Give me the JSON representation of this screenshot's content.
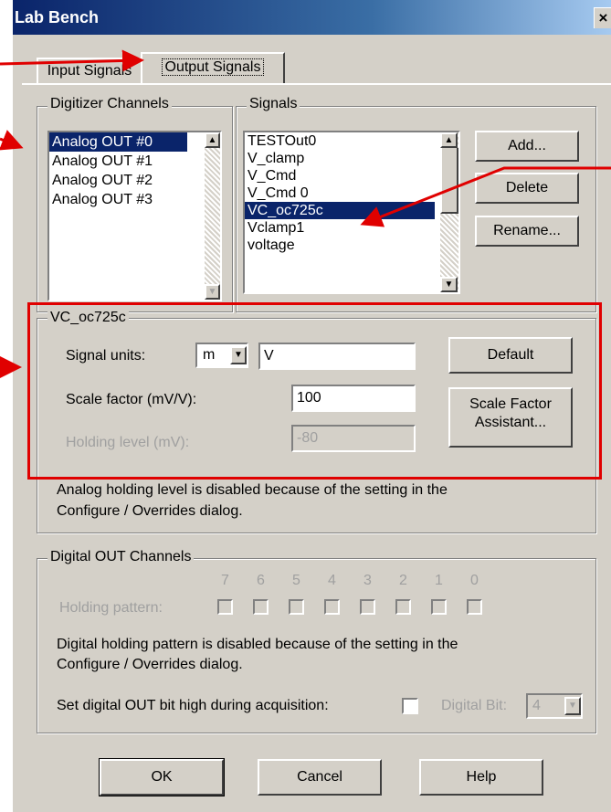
{
  "window": {
    "title": "Lab Bench",
    "close_glyph": "×"
  },
  "tabs": [
    {
      "label": "Input Signals",
      "active": false
    },
    {
      "label": "Output Signals",
      "active": true
    }
  ],
  "digitizer_channels": {
    "title": "Digitizer Channels",
    "items": [
      "Analog OUT #0",
      "Analog OUT #1",
      "Analog OUT #2",
      "Analog OUT #3"
    ],
    "selected_index": 0
  },
  "signals": {
    "title": "Signals",
    "items": [
      "TESTOut0",
      "V_clamp",
      "V_Cmd",
      "V_Cmd 0",
      "VC_oc725c",
      "Vclamp1",
      "voltage"
    ],
    "selected_index": 4,
    "buttons": {
      "add": "Add...",
      "delete": "Delete",
      "rename": "Rename..."
    }
  },
  "signal_settings": {
    "title": "VC_oc725c",
    "units_label": "Signal units:",
    "units_prefix": "m",
    "units_value": "V",
    "scale_label": "Scale factor (mV/V):",
    "scale_value": "100",
    "holding_label": "Holding level (mV):",
    "holding_value": "-80",
    "default_button": "Default",
    "assistant_button_line1": "Scale Factor",
    "assistant_button_line2": "Assistant...",
    "analog_note_line1": "Analog holding level is disabled because of the setting in the",
    "analog_note_line2": "Configure / Overrides dialog."
  },
  "digital_out": {
    "title": "Digital OUT Channels",
    "bit_numbers": [
      "7",
      "6",
      "5",
      "4",
      "3",
      "2",
      "1",
      "0"
    ],
    "holding_label": "Holding pattern:",
    "note_line1": "Digital holding pattern is disabled because of the setting in the",
    "note_line2": "Configure / Overrides dialog.",
    "set_high_label": "Set digital OUT bit high during acquisition:",
    "digital_bit_label": "Digital Bit:",
    "digital_bit_value": "4"
  },
  "footer_buttons": {
    "ok": "OK",
    "cancel": "Cancel",
    "help": "Help"
  },
  "annotation_color": "#e00000",
  "selection_color": "#0a246a"
}
